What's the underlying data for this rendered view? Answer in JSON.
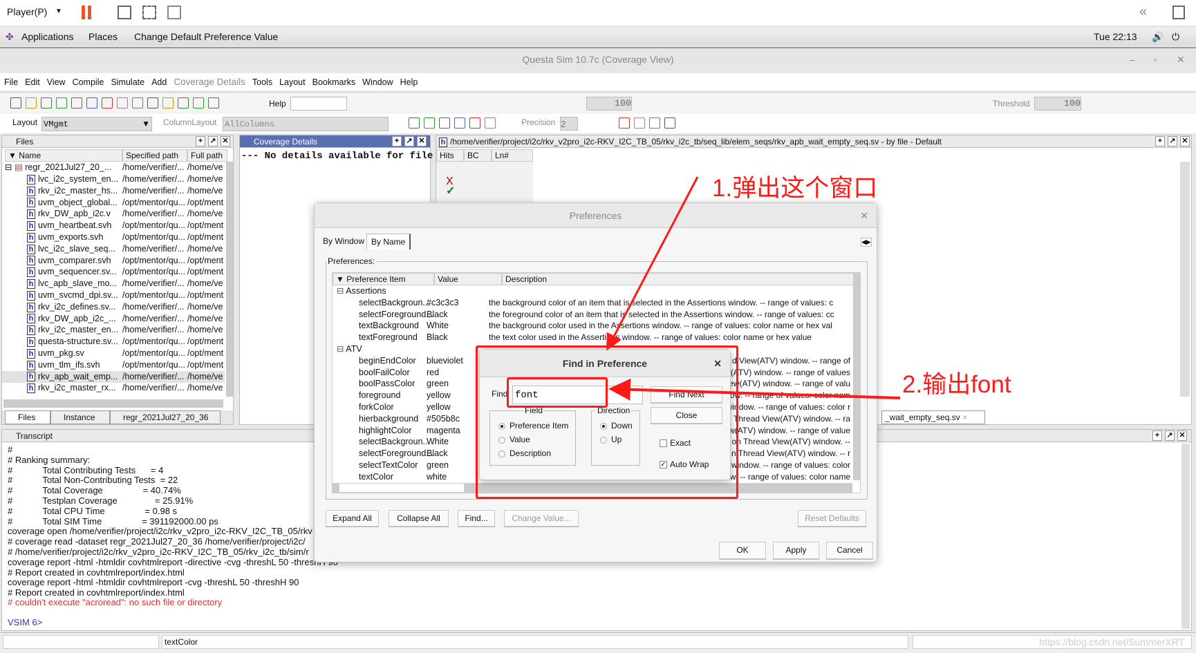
{
  "player_bar": {
    "player_label": "Player(P)",
    "icons": [
      "pause-icon",
      "send-keys-icon",
      "fit-guest-icon",
      "unity-icon"
    ],
    "right_icons": [
      "collapse-icon",
      "library-icon"
    ]
  },
  "gnome_bar": {
    "applications": "Applications",
    "places": "Places",
    "active_window": "Change Default Preference Value",
    "clock": "Tue 22:13",
    "icons": [
      "volume-icon",
      "power-icon"
    ]
  },
  "window": {
    "title": "Questa Sim 10.7c (Coverage View)"
  },
  "menu": [
    "File",
    "Edit",
    "View",
    "Compile",
    "Simulate",
    "Add",
    "Coverage Details",
    "Tools",
    "Layout",
    "Bookmarks",
    "Window",
    "Help"
  ],
  "toolbar": {
    "help_label": "Help",
    "help_value": "",
    "zoom_value": "100",
    "threshold_label": "Threshold",
    "threshold_value": "100",
    "layout_label": "Layout",
    "layout_value": "VMgmt",
    "column_layout_label": "ColumnLayout",
    "column_layout_value": "AllColumns",
    "precision_label": "Precision",
    "precision_value": "2"
  },
  "files_pane": {
    "title": "Files",
    "columns": [
      "Name",
      "Specified path",
      "Full path"
    ],
    "root": {
      "name": "regr_2021Jul27_20_...",
      "spec": "/home/verifier/...",
      "full": "/home/ve"
    },
    "rows": [
      {
        "name": "lvc_i2c_system_en...",
        "spec": "/home/verifier/...",
        "full": "/home/ve"
      },
      {
        "name": "rkv_i2c_master_hs...",
        "spec": "/home/verifier/...",
        "full": "/home/ve"
      },
      {
        "name": "uvm_object_global...",
        "spec": "/opt/mentor/qu...",
        "full": "/opt/ment"
      },
      {
        "name": "rkv_DW_apb_i2c.v",
        "spec": "/home/verifier/...",
        "full": "/home/ve"
      },
      {
        "name": "uvm_heartbeat.svh",
        "spec": "/opt/mentor/qu...",
        "full": "/opt/ment"
      },
      {
        "name": "uvm_exports.svh",
        "spec": "/opt/mentor/qu...",
        "full": "/opt/ment"
      },
      {
        "name": "lvc_i2c_slave_seq...",
        "spec": "/home/verifier/...",
        "full": "/home/ve"
      },
      {
        "name": "uvm_comparer.svh",
        "spec": "/opt/mentor/qu...",
        "full": "/opt/ment"
      },
      {
        "name": "uvm_sequencer.sv...",
        "spec": "/opt/mentor/qu...",
        "full": "/opt/ment"
      },
      {
        "name": "lvc_apb_slave_mo...",
        "spec": "/home/verifier/...",
        "full": "/home/ve"
      },
      {
        "name": "uvm_svcmd_dpi.sv...",
        "spec": "/opt/mentor/qu...",
        "full": "/opt/ment"
      },
      {
        "name": "rkv_i2c_defines.sv...",
        "spec": "/home/verifier/...",
        "full": "/home/ve"
      },
      {
        "name": "rkv_DW_apb_i2c_...",
        "spec": "/home/verifier/...",
        "full": "/home/ve"
      },
      {
        "name": "rkv_i2c_master_en...",
        "spec": "/home/verifier/...",
        "full": "/home/ve"
      },
      {
        "name": "questa-structure.sv...",
        "spec": "/opt/mentor/qu...",
        "full": "/opt/ment"
      },
      {
        "name": "uvm_pkg.sv",
        "spec": "/opt/mentor/qu...",
        "full": "/opt/ment"
      },
      {
        "name": "uvm_tlm_ifs.svh",
        "spec": "/opt/mentor/qu...",
        "full": "/opt/ment"
      },
      {
        "name": "rkv_apb_wait_emp...",
        "spec": "/home/verifier/...",
        "full": "/home/ve",
        "selected": true
      },
      {
        "name": "rkv_i2c_master_rx...",
        "spec": "/home/verifier/...",
        "full": "/home/ve"
      }
    ],
    "tabs": [
      "Files",
      "Instance",
      "regr_2021Jul27_20_36"
    ]
  },
  "coverage_pane": {
    "title": "Coverage Details",
    "text": "--- No details available for file"
  },
  "source_pane": {
    "title": "/home/verifier/project/i2c/rkv_v2pro_i2c-RKV_I2C_TB_05/rkv_i2c_tb/seq_lib/elem_seqs/rkv_apb_wait_empty_seq.sv - by file - Default",
    "columns": [
      "Hits",
      "BC",
      "Ln#"
    ],
    "tab": "_wait_empty_seq.sv"
  },
  "transcript": {
    "title": "Transcript",
    "lines": [
      "#",
      "# Ranking summary:",
      "#            Total Contributing Tests      = 4",
      "#            Total Non-Contributing Tests  = 22",
      "#            Total Coverage                = 40.74%",
      "#            Testplan Coverage               = 25.91%",
      "#            Total CPU Time                = 0.98 s",
      "#            Total SIM Time                = 391192000.00 ps",
      "coverage open /home/verifier/project/i2c/rkv_v2pro_i2c-RKV_I2C_TB_05/rkv",
      "# coverage read -dataset regr_2021Jul27_20_36 /home/verifier/project/i2c/",
      "# /home/verifier/project/i2c/rkv_v2pro_i2c-RKV_I2C_TB_05/rkv_i2c_tb/sim/r",
      "coverage report -html -htmldir covhtmlreport -directive -cvg -threshL 50 -threshH 90",
      "# Report created in covhtmlreport/index.html",
      "coverage report -html -htmldir covhtmlreport -cvg -threshL 50 -threshH 90",
      "# Report created in covhtmlreport/index.html"
    ],
    "error": "# couldn't execute \"acroread\": no such file or directory",
    "prompt": "VSIM 6>"
  },
  "status_bar": {
    "field": "textColor",
    "watermark": "https://blog.csdn.net/SummerXRT"
  },
  "preferences": {
    "title": "Preferences",
    "tabs": [
      "By Window",
      "By Name"
    ],
    "group_label": "Preferences:",
    "columns": [
      "Preference Item",
      "Value",
      "Description"
    ],
    "groups": [
      {
        "name": "Assertions",
        "items": [
          {
            "item": "selectBackgroun...",
            "value": "#c3c3c3",
            "desc": "the background color of an item that is selected in the Assertions window. -- range of values: c"
          },
          {
            "item": "selectForeground...",
            "value": "Black",
            "desc": "the foreground color of an item that is selected in the Assertions window. -- range of values: cc"
          },
          {
            "item": "textBackground",
            "value": "White",
            "desc": "the background color used in the Assertions window. -- range of values: color name or hex val"
          },
          {
            "item": "textForeground",
            "value": "Black",
            "desc": "the text color used in the Assertions window. -- range of values: color name or hex value"
          }
        ]
      },
      {
        "name": "ATV",
        "items": [
          {
            "item": "beginEndColor",
            "value": "blueviolet",
            "desc": "d View(ATV) window. -- range of"
          },
          {
            "item": "boolFailColor",
            "value": "red",
            "desc": "(ATV) window. -- range of values"
          },
          {
            "item": "boolPassColor",
            "value": "green",
            "desc": "ew(ATV) window. -- range of valu"
          },
          {
            "item": "foreground",
            "value": "yellow",
            "desc": "dow. -- range of values: color nam"
          },
          {
            "item": "forkColor",
            "value": "yellow",
            "desc": "window. -- range of values: color r"
          },
          {
            "item": "hierbackground",
            "value": "#505b8c",
            "desc": "Thread View(ATV) window. -- ra"
          },
          {
            "item": "highlightColor",
            "value": "magenta",
            "desc": "w(ATV) window. -- range of value"
          },
          {
            "item": "selectBackgroun...",
            "value": "White",
            "desc": "on Thread View(ATV) window. --"
          },
          {
            "item": "selectForeground...",
            "value": "Black",
            "desc": "n Thread View(ATV) window. -- r"
          },
          {
            "item": "selectTextColor",
            "value": "green",
            "desc": "window. -- range of values: color"
          },
          {
            "item": "textColor",
            "value": "white",
            "desc": "w. -- range of values: color name"
          }
        ]
      }
    ],
    "buttons": {
      "expand_all": "Expand All",
      "collapse_all": "Collapse All",
      "find": "Find...",
      "change_value": "Change Value...",
      "reset_defaults": "Reset Defaults",
      "ok": "OK",
      "apply": "Apply",
      "cancel": "Cancel"
    }
  },
  "find_dialog": {
    "title": "Find in Preference",
    "find_label": "Find",
    "find_value": "font",
    "find_next": "Find Next",
    "close": "Close",
    "field_label": "Field",
    "field_options": [
      "Preference Item",
      "Value",
      "Description"
    ],
    "field_selected": "Preference Item",
    "direction_label": "Direction",
    "direction_options": [
      "Down",
      "Up"
    ],
    "direction_selected": "Down",
    "exact_label": "Exact",
    "exact_checked": false,
    "autowrap_label": "Auto Wrap",
    "autowrap_checked": true
  },
  "annotations": {
    "step1": "1.弹出这个窗口",
    "step2": "2.输出font",
    "color": "#ff1a1a"
  }
}
